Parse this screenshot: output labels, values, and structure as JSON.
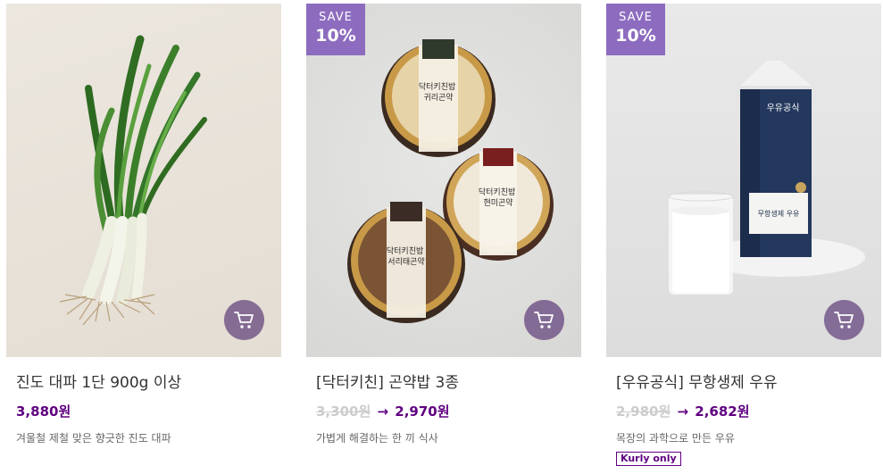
{
  "products": [
    {
      "name": "진도 대파 1단 900g 이상",
      "price": "3,880원",
      "description": "겨울철 제철 맞은 향긋한 진도 대파"
    },
    {
      "badge": {
        "line1": "SAVE",
        "line2": "10%"
      },
      "name": "[닥터키친] 곤약밥 3종",
      "original_price": "3,300원",
      "arrow": "→",
      "sale_price": "2,970원",
      "description": "가볍게 해결하는 한 끼 식사",
      "package_labels": [
        "닥터키친밥 귀리곤약",
        "닥터키친밥 현미곤약",
        "닥터키친밥 서리태곤약"
      ]
    },
    {
      "badge": {
        "line1": "SAVE",
        "line2": "10%"
      },
      "name": "[우유공식] 무항생제 우유",
      "original_price": "2,980원",
      "arrow": "→",
      "sale_price": "2,682원",
      "description": "목장의 과학으로 만든 우유",
      "tag": "Kurly only",
      "carton_labels": [
        "우유공식",
        "무항생제 우유"
      ]
    }
  ],
  "icons": {
    "cart": "cart-icon"
  },
  "colors": {
    "brand": "#5f0080",
    "badge": "#8d6cbf",
    "cart_button": "#60407a"
  }
}
